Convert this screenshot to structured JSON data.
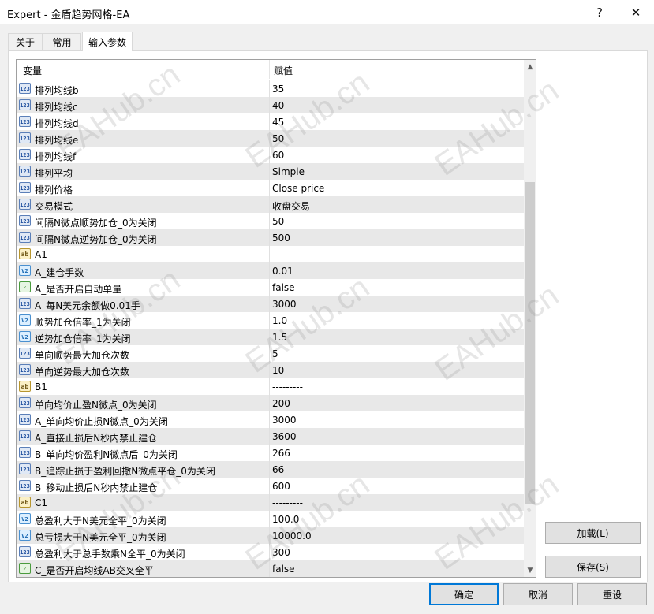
{
  "window": {
    "title": "Expert - 金盾趋势网格-EA",
    "help_glyph": "?",
    "close_glyph": "✕"
  },
  "tabs": [
    {
      "label": "关于"
    },
    {
      "label": "常用"
    },
    {
      "label": "输入参数"
    }
  ],
  "grid": {
    "col_variable": "变量",
    "col_value": "赋值",
    "rows": [
      {
        "icon": "int",
        "name": "排列均线b",
        "value": "35"
      },
      {
        "icon": "int",
        "name": "排列均线c",
        "value": "40"
      },
      {
        "icon": "int",
        "name": "排列均线d",
        "value": "45"
      },
      {
        "icon": "int",
        "name": "排列均线e",
        "value": "50"
      },
      {
        "icon": "int",
        "name": "排列均线f",
        "value": "60"
      },
      {
        "icon": "int",
        "name": "排列平均",
        "value": "Simple"
      },
      {
        "icon": "int",
        "name": "排列价格",
        "value": "Close price"
      },
      {
        "icon": "int",
        "name": "交易模式",
        "value": "收盘交易"
      },
      {
        "icon": "int",
        "name": "间隔N微点顺势加仓_0为关闭",
        "value": "50"
      },
      {
        "icon": "int",
        "name": "间隔N微点逆势加仓_0为关闭",
        "value": "500"
      },
      {
        "icon": "str",
        "name": "A1",
        "value": "---------"
      },
      {
        "icon": "dbl",
        "name": "A_建仓手数",
        "value": "0.01"
      },
      {
        "icon": "bool",
        "name": "A_是否开启自动单量",
        "value": "false"
      },
      {
        "icon": "int",
        "name": "A_每N美元余额做0.01手",
        "value": "3000"
      },
      {
        "icon": "dbl",
        "name": "顺势加仓倍率_1为关闭",
        "value": "1.0"
      },
      {
        "icon": "dbl",
        "name": "逆势加仓倍率_1为关闭",
        "value": "1.5"
      },
      {
        "icon": "int",
        "name": "单向顺势最大加仓次数",
        "value": "5"
      },
      {
        "icon": "int",
        "name": "单向逆势最大加仓次数",
        "value": "10"
      },
      {
        "icon": "str",
        "name": "B1",
        "value": "---------"
      },
      {
        "icon": "int",
        "name": "单向均价止盈N微点_0为关闭",
        "value": "200"
      },
      {
        "icon": "int",
        "name": "A_单向均价止损N微点_0为关闭",
        "value": "3000"
      },
      {
        "icon": "int",
        "name": "A_直接止损后N秒内禁止建仓",
        "value": "3600"
      },
      {
        "icon": "int",
        "name": "B_单向均价盈利N微点后_0为关闭",
        "value": "266"
      },
      {
        "icon": "int",
        "name": "B_追踪止损于盈利回撤N微点平仓_0为关闭",
        "value": "66"
      },
      {
        "icon": "int",
        "name": "B_移动止损后N秒内禁止建仓",
        "value": "600"
      },
      {
        "icon": "str",
        "name": "C1",
        "value": "---------"
      },
      {
        "icon": "dbl",
        "name": "总盈利大于N美元全平_0为关闭",
        "value": "100.0"
      },
      {
        "icon": "dbl",
        "name": "总亏损大于N美元全平_0为关闭",
        "value": "10000.0"
      },
      {
        "icon": "int",
        "name": "总盈利大于总手数乘N全平_0为关闭",
        "value": "300"
      },
      {
        "icon": "bool",
        "name": "C_是否开启均线AB交叉全平",
        "value": "false"
      }
    ]
  },
  "icon_labels": {
    "int": "123",
    "str": "ab",
    "dbl": "V2",
    "bool": "✓"
  },
  "buttons": {
    "load": "加载(L)",
    "save": "保存(S)",
    "ok": "确定",
    "cancel": "取消",
    "reset": "重设"
  },
  "watermark": "EAHub.cn"
}
